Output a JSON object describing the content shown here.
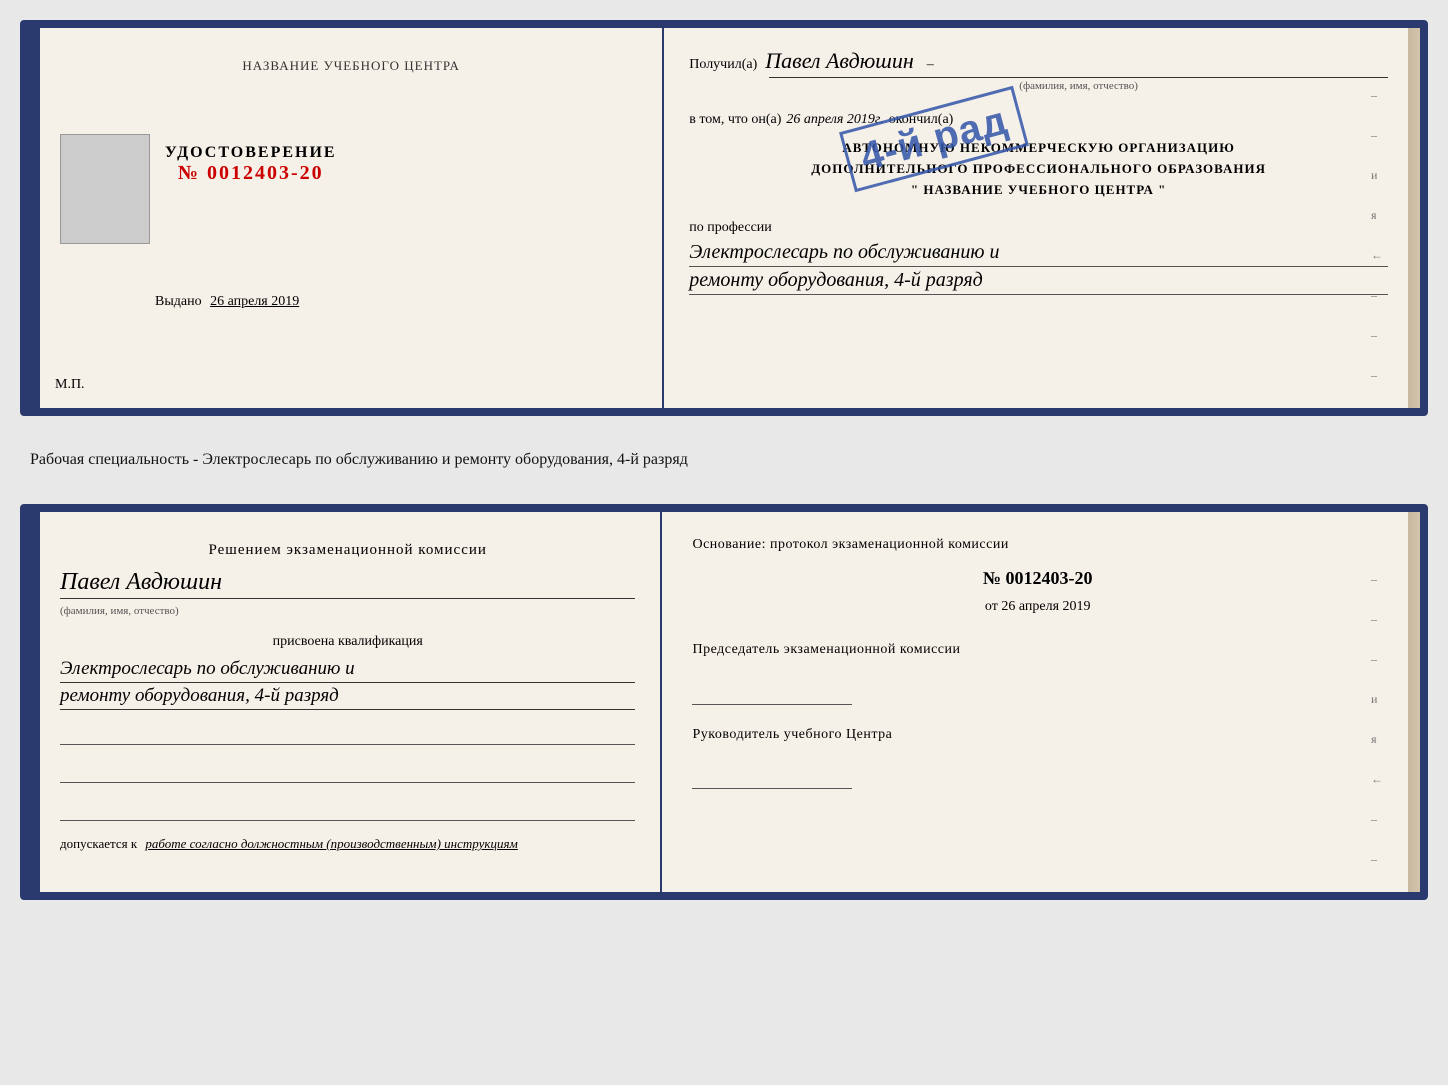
{
  "page": {
    "background": "#e0ddd8"
  },
  "top_document": {
    "left": {
      "center_name": "НАЗВАНИЕ УЧЕБНОГО ЦЕНТРА",
      "udostoverenie_title": "УДОСТОВЕРЕНИЕ",
      "number_label": "№",
      "number_value": "0012403-20",
      "vydano_label": "Выдано",
      "vydano_date": "26 апреля 2019",
      "mp_label": "М.П."
    },
    "right": {
      "poluchil_label": "Получил(а)",
      "person_name": "Павел Авдюшин",
      "fio_label": "(фамилия, имя, отчество)",
      "vtom_label": "в том, что он(а)",
      "vtom_date": "26 апреля 2019г.",
      "okonchil_label": "окончил(а)",
      "stamp_line1": "4-й рад",
      "org_line1": "АВТОНОМНУЮ НЕКОММЕРЧЕСКУЮ ОРГАНИЗАЦИЮ",
      "org_line2": "ДОПОЛНИТЕЛЬНОГО ПРОФЕССИОНАЛЬНОГО ОБРАЗОВАНИЯ",
      "org_line3": "\" НАЗВАНИЕ УЧЕБНОГО ЦЕНТРА \"",
      "profession_label": "по профессии",
      "profession_line1": "Электрослесарь по обслуживанию и",
      "profession_line2": "ремонту оборудования, 4-й разряд"
    }
  },
  "specialty_text": "Рабочая специальность - Электрослесарь по обслуживанию и ремонту оборудования, 4-й разряд",
  "bottom_document": {
    "left": {
      "decision_title": "Решением экзаменационной комиссии",
      "person_name": "Павел Авдюшин",
      "fio_label": "(фамилия, имя, отчество)",
      "prisvoena_label": "присвоена квалификация",
      "qual_line1": "Электрослесарь по обслуживанию и",
      "qual_line2": "ремонту оборудования, 4-й разряд",
      "dopuskaetsya_label": "допускается к",
      "dopuskaetsya_value": "работе согласно должностным (производственным) инструкциям"
    },
    "right": {
      "osnovaniye_text": "Основание: протокол экзаменационной комиссии",
      "number_label": "№",
      "number_value": "0012403-20",
      "ot_label": "от",
      "ot_date": "26 апреля 2019",
      "predsedatel_title": "Председатель экзаменационной комиссии",
      "rukovoditel_title": "Руководитель учебного Центра"
    }
  },
  "deco": {
    "dash": "–",
    "and_ru": "и",
    "ya_ru": "я",
    "l_arrow": "←"
  }
}
